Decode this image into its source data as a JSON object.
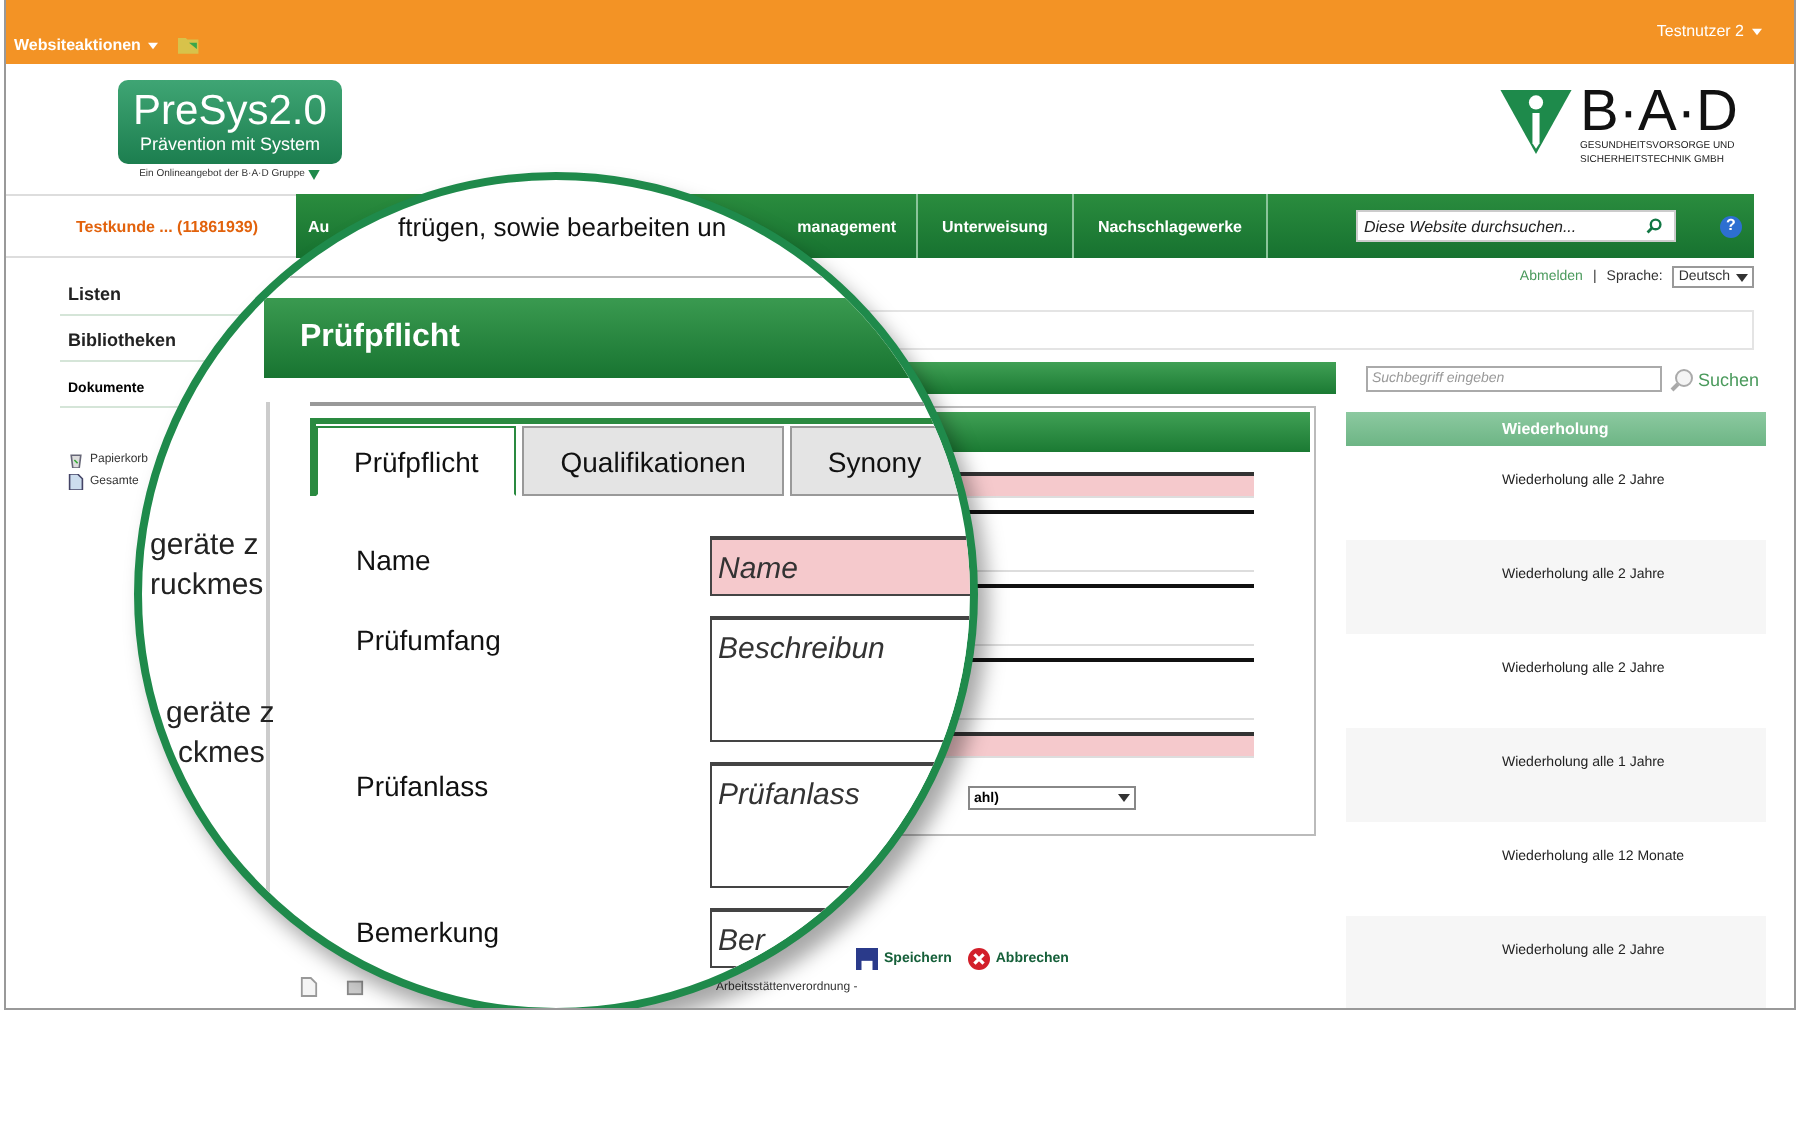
{
  "top_bar": {
    "site_actions": "Websiteaktionen",
    "user": "Testnutzer 2"
  },
  "logo": {
    "name": "PreSys2.0",
    "tagline": "Prävention mit System",
    "note": "Ein Onlineangebot der B·A·D Gruppe"
  },
  "company_logo": {
    "name": "B·A·D",
    "line_1": "GESUNDHEITSVORSORGE UND",
    "line_2": "SICHERHEITSTECHNIK GMBH"
  },
  "customer": "Testkunde ... (11861939)",
  "nav_tabs": [
    {
      "label_start": "Au",
      "label_end": "management"
    },
    {
      "label_start": "Unterweisung"
    },
    {
      "label_start": "Nachschlagewerke"
    }
  ],
  "site_search": {
    "placeholder": "Diese Website durchsuchen..."
  },
  "help": "?",
  "user_links": {
    "logout": "Abmelden",
    "separator": "|",
    "language_label": "Sprache:",
    "language": "Deutsch"
  },
  "sidebar": {
    "items": [
      {
        "label": "Listen",
        "kind": "heading"
      },
      {
        "label": "Bibliotheken",
        "kind": "heading"
      },
      {
        "label": "Dokumente",
        "kind": "link"
      }
    ]
  },
  "sidebar_links": [
    {
      "label": "Papierkorb",
      "kind": "bin"
    },
    {
      "label": "Gesamte",
      "kind": "content"
    }
  ],
  "dialog": {
    "field_strips": [
      {
        "required": true
      },
      {
        "required": false
      },
      {
        "required": false
      },
      {
        "required": false
      },
      {
        "required": true
      }
    ],
    "select_value": "ahl)",
    "buttons": [
      {
        "label": "Speichern",
        "kind": "save"
      },
      {
        "label": "Abbrechen",
        "kind": "cancel"
      }
    ],
    "footer_text": "Arbeitsstättenverordnung -"
  },
  "list_search": {
    "placeholder": "Suchbegriff eingeben",
    "button": "Suchen"
  },
  "table": {
    "columns": [
      "Wiederholung"
    ],
    "rows": [
      [
        "Wiederholung alle 2 Jahre"
      ],
      [
        "Wiederholung alle 2 Jahre"
      ],
      [
        "Wiederholung alle 2 Jahre"
      ],
      [
        "Wiederholung alle 1 Jahre"
      ],
      [
        "Wiederholung alle 12 Monate"
      ],
      [
        "Wiederholung alle 2 Jahre"
      ]
    ]
  },
  "magnifier": {
    "heading": "ftrügen, sowie bearbeiten un",
    "title": "Prüfpflicht",
    "fragments": [
      "geräte z",
      "ruckmes",
      "geräte z",
      "ckmes"
    ],
    "tabs": [
      {
        "label": "Prüfpflicht",
        "selected": true
      },
      {
        "label": "Qualifikationen",
        "selected": false
      },
      {
        "label": "Synony",
        "selected": false
      }
    ],
    "fields": [
      {
        "label": "Name",
        "placeholder": "Name",
        "required": true,
        "kind": "line"
      },
      {
        "label": "Prüfumfang",
        "placeholder": "Beschreibun",
        "required": false,
        "kind": "area"
      },
      {
        "label": "Prüfanlass",
        "placeholder": "Prüfanlass",
        "required": false,
        "kind": "area"
      },
      {
        "label": "Bemerkung",
        "placeholder": "Ber",
        "required": false,
        "kind": "line"
      }
    ]
  }
}
